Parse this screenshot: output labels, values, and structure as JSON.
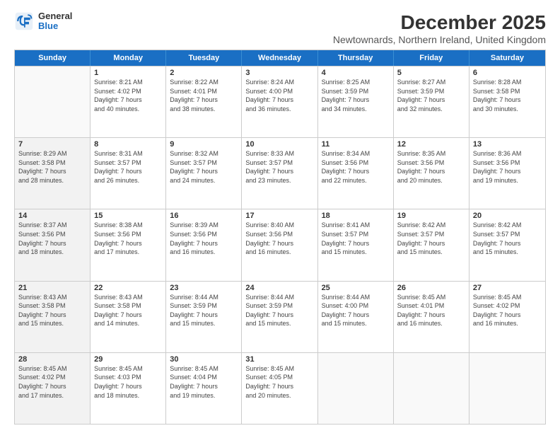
{
  "header": {
    "logo_general": "General",
    "logo_blue": "Blue",
    "month_title": "December 2025",
    "location": "Newtownards, Northern Ireland, United Kingdom"
  },
  "days_of_week": [
    "Sunday",
    "Monday",
    "Tuesday",
    "Wednesday",
    "Thursday",
    "Friday",
    "Saturday"
  ],
  "rows": [
    [
      {
        "day": "",
        "info": "",
        "empty": true
      },
      {
        "day": "1",
        "info": "Sunrise: 8:21 AM\nSunset: 4:02 PM\nDaylight: 7 hours\nand 40 minutes."
      },
      {
        "day": "2",
        "info": "Sunrise: 8:22 AM\nSunset: 4:01 PM\nDaylight: 7 hours\nand 38 minutes."
      },
      {
        "day": "3",
        "info": "Sunrise: 8:24 AM\nSunset: 4:00 PM\nDaylight: 7 hours\nand 36 minutes."
      },
      {
        "day": "4",
        "info": "Sunrise: 8:25 AM\nSunset: 3:59 PM\nDaylight: 7 hours\nand 34 minutes."
      },
      {
        "day": "5",
        "info": "Sunrise: 8:27 AM\nSunset: 3:59 PM\nDaylight: 7 hours\nand 32 minutes."
      },
      {
        "day": "6",
        "info": "Sunrise: 8:28 AM\nSunset: 3:58 PM\nDaylight: 7 hours\nand 30 minutes."
      }
    ],
    [
      {
        "day": "7",
        "info": "Sunrise: 8:29 AM\nSunset: 3:58 PM\nDaylight: 7 hours\nand 28 minutes.",
        "shaded": true
      },
      {
        "day": "8",
        "info": "Sunrise: 8:31 AM\nSunset: 3:57 PM\nDaylight: 7 hours\nand 26 minutes."
      },
      {
        "day": "9",
        "info": "Sunrise: 8:32 AM\nSunset: 3:57 PM\nDaylight: 7 hours\nand 24 minutes."
      },
      {
        "day": "10",
        "info": "Sunrise: 8:33 AM\nSunset: 3:57 PM\nDaylight: 7 hours\nand 23 minutes."
      },
      {
        "day": "11",
        "info": "Sunrise: 8:34 AM\nSunset: 3:56 PM\nDaylight: 7 hours\nand 22 minutes."
      },
      {
        "day": "12",
        "info": "Sunrise: 8:35 AM\nSunset: 3:56 PM\nDaylight: 7 hours\nand 20 minutes."
      },
      {
        "day": "13",
        "info": "Sunrise: 8:36 AM\nSunset: 3:56 PM\nDaylight: 7 hours\nand 19 minutes."
      }
    ],
    [
      {
        "day": "14",
        "info": "Sunrise: 8:37 AM\nSunset: 3:56 PM\nDaylight: 7 hours\nand 18 minutes.",
        "shaded": true
      },
      {
        "day": "15",
        "info": "Sunrise: 8:38 AM\nSunset: 3:56 PM\nDaylight: 7 hours\nand 17 minutes."
      },
      {
        "day": "16",
        "info": "Sunrise: 8:39 AM\nSunset: 3:56 PM\nDaylight: 7 hours\nand 16 minutes."
      },
      {
        "day": "17",
        "info": "Sunrise: 8:40 AM\nSunset: 3:56 PM\nDaylight: 7 hours\nand 16 minutes."
      },
      {
        "day": "18",
        "info": "Sunrise: 8:41 AM\nSunset: 3:57 PM\nDaylight: 7 hours\nand 15 minutes."
      },
      {
        "day": "19",
        "info": "Sunrise: 8:42 AM\nSunset: 3:57 PM\nDaylight: 7 hours\nand 15 minutes."
      },
      {
        "day": "20",
        "info": "Sunrise: 8:42 AM\nSunset: 3:57 PM\nDaylight: 7 hours\nand 15 minutes."
      }
    ],
    [
      {
        "day": "21",
        "info": "Sunrise: 8:43 AM\nSunset: 3:58 PM\nDaylight: 7 hours\nand 15 minutes.",
        "shaded": true
      },
      {
        "day": "22",
        "info": "Sunrise: 8:43 AM\nSunset: 3:58 PM\nDaylight: 7 hours\nand 14 minutes."
      },
      {
        "day": "23",
        "info": "Sunrise: 8:44 AM\nSunset: 3:59 PM\nDaylight: 7 hours\nand 15 minutes."
      },
      {
        "day": "24",
        "info": "Sunrise: 8:44 AM\nSunset: 3:59 PM\nDaylight: 7 hours\nand 15 minutes."
      },
      {
        "day": "25",
        "info": "Sunrise: 8:44 AM\nSunset: 4:00 PM\nDaylight: 7 hours\nand 15 minutes."
      },
      {
        "day": "26",
        "info": "Sunrise: 8:45 AM\nSunset: 4:01 PM\nDaylight: 7 hours\nand 16 minutes."
      },
      {
        "day": "27",
        "info": "Sunrise: 8:45 AM\nSunset: 4:02 PM\nDaylight: 7 hours\nand 16 minutes."
      }
    ],
    [
      {
        "day": "28",
        "info": "Sunrise: 8:45 AM\nSunset: 4:02 PM\nDaylight: 7 hours\nand 17 minutes.",
        "shaded": true
      },
      {
        "day": "29",
        "info": "Sunrise: 8:45 AM\nSunset: 4:03 PM\nDaylight: 7 hours\nand 18 minutes."
      },
      {
        "day": "30",
        "info": "Sunrise: 8:45 AM\nSunset: 4:04 PM\nDaylight: 7 hours\nand 19 minutes."
      },
      {
        "day": "31",
        "info": "Sunrise: 8:45 AM\nSunset: 4:05 PM\nDaylight: 7 hours\nand 20 minutes."
      },
      {
        "day": "",
        "info": "",
        "empty": true
      },
      {
        "day": "",
        "info": "",
        "empty": true
      },
      {
        "day": "",
        "info": "",
        "empty": true
      }
    ]
  ]
}
